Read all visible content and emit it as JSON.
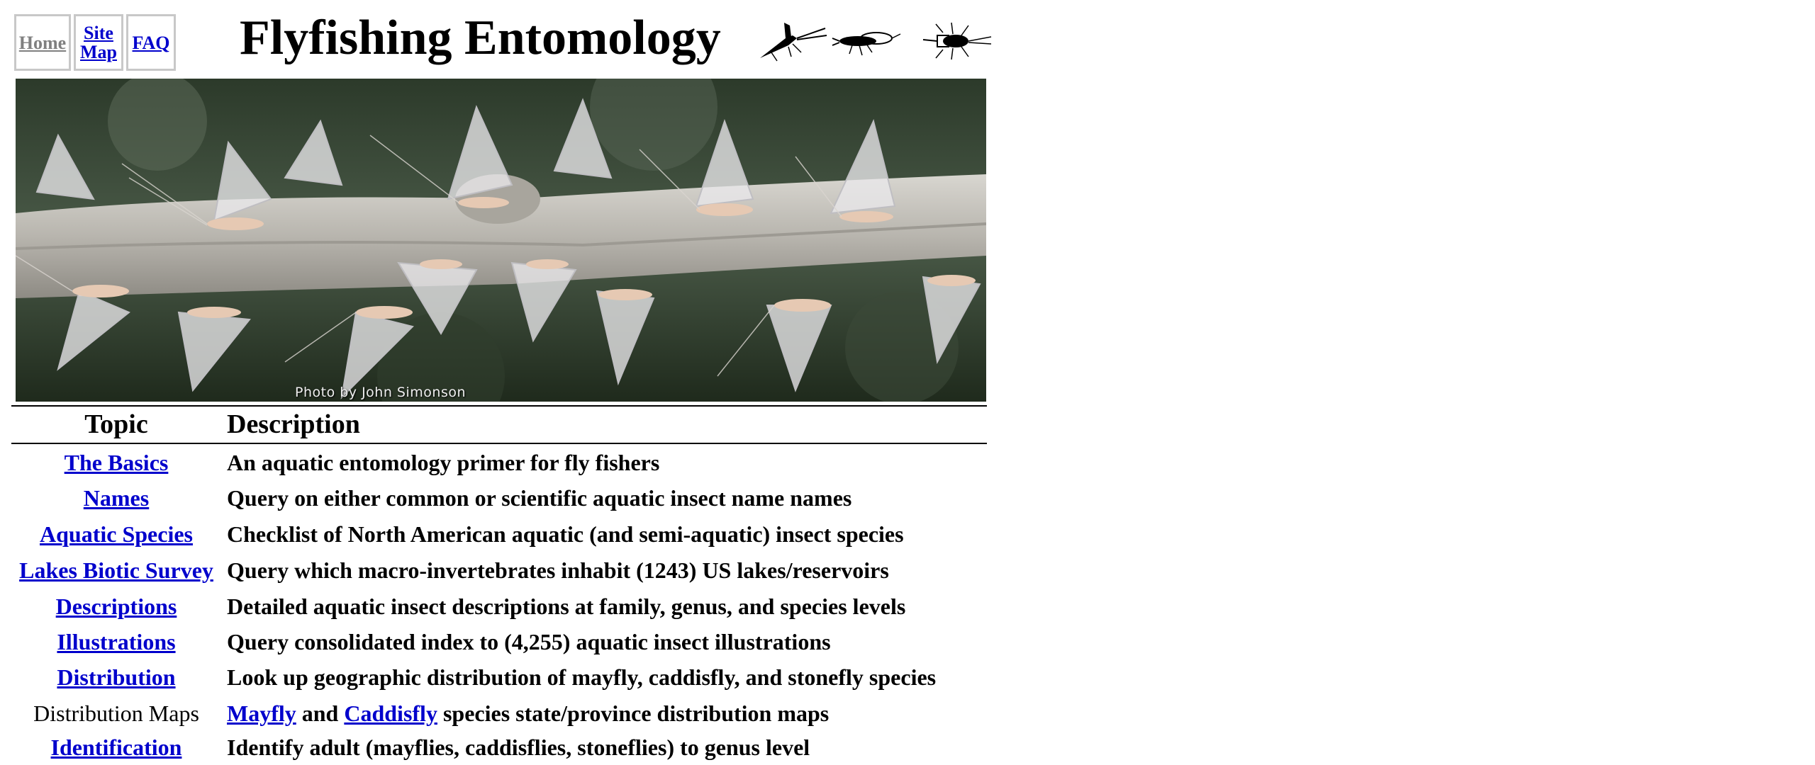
{
  "nav": {
    "home": "Home",
    "site_map_line1": "Site",
    "site_map_line2": "Map",
    "faq": "FAQ"
  },
  "header": {
    "title": "Flyfishing Entomology",
    "icons": [
      "mayfly-icon",
      "stonefly-icon",
      "caddisfly-icon"
    ]
  },
  "hero": {
    "photo_credit": "Photo by John Simonson"
  },
  "table": {
    "headers": {
      "topic": "Topic",
      "description": "Description"
    },
    "rows": [
      {
        "topic": "The Basics",
        "description": "An aquatic entomology primer for fly fishers"
      },
      {
        "topic": "Names",
        "description": "Query on either common or scientific aquatic insect name names"
      },
      {
        "topic": "Aquatic Species",
        "description": "Checklist of North American aquatic (and semi-aquatic) insect species"
      },
      {
        "topic": "Lakes Biotic Survey",
        "description": "Query which macro-invertebrates inhabit (1243) US lakes/reservoirs"
      },
      {
        "topic": "Descriptions",
        "description": "Detailed aquatic insect descriptions at family, genus, and species levels"
      },
      {
        "topic": "Illustrations",
        "description": "Query consolidated index to (4,255) aquatic insect illustrations"
      },
      {
        "topic": "Distribution",
        "description": "Look up geographic distribution of mayfly, caddisfly, and stonefly species"
      },
      {
        "topic": "Distribution Maps",
        "desc_link1": "Mayfly",
        "desc_and": "and",
        "desc_link2": "Caddisfly",
        "desc_rest": "species state/province distribution maps"
      },
      {
        "topic": "Identification",
        "description": "Identify adult (mayflies, caddisflies, stoneflies) to genus level"
      }
    ]
  },
  "colors": {
    "link": "#0000cc",
    "visited": "#808080",
    "background": "#ffffff"
  }
}
